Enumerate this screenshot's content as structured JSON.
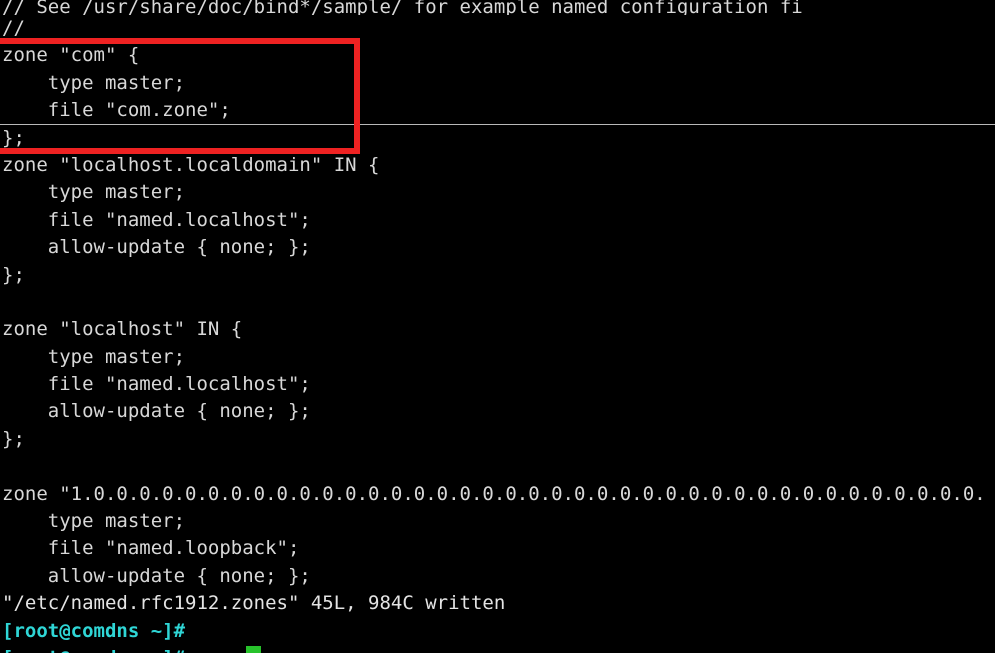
{
  "terminal": {
    "background_color": "#000000",
    "foreground_color": "#d8d8d8",
    "prompt_color": "#2fd6d6",
    "cursor_color": "#27c22b",
    "separator_color": "#b9b9b9",
    "font_size_px": 19,
    "line_height_px": 27.4
  },
  "annotation": {
    "highlight_color": "#ee2222",
    "shape": "rectangle",
    "target_label": "com-zone-block"
  },
  "lines": [
    {
      "id": "l0",
      "text": "// See /usr/share/doc/bind*/sample/ for example named configuration fi",
      "kind": "comment"
    },
    {
      "id": "l1",
      "text": "//",
      "kind": "comment"
    },
    {
      "id": "l2",
      "text": "zone \"com\" {",
      "kind": "config"
    },
    {
      "id": "l3",
      "text": "    type master;",
      "kind": "config"
    },
    {
      "id": "l4",
      "text": "    file \"com.zone\";",
      "kind": "config"
    },
    {
      "id": "l5",
      "text": "};",
      "kind": "config"
    },
    {
      "id": "l6",
      "text": "zone \"localhost.localdomain\" IN {",
      "kind": "config"
    },
    {
      "id": "l7",
      "text": "    type master;",
      "kind": "config"
    },
    {
      "id": "l8",
      "text": "    file \"named.localhost\";",
      "kind": "config"
    },
    {
      "id": "l9",
      "text": "    allow-update { none; };",
      "kind": "config"
    },
    {
      "id": "l10",
      "text": "};",
      "kind": "config"
    },
    {
      "id": "l11",
      "text": "",
      "kind": "blank"
    },
    {
      "id": "l12",
      "text": "zone \"localhost\" IN {",
      "kind": "config"
    },
    {
      "id": "l13",
      "text": "    type master;",
      "kind": "config"
    },
    {
      "id": "l14",
      "text": "    file \"named.localhost\";",
      "kind": "config"
    },
    {
      "id": "l15",
      "text": "    allow-update { none; };",
      "kind": "config"
    },
    {
      "id": "l16",
      "text": "};",
      "kind": "config"
    },
    {
      "id": "l17",
      "text": "",
      "kind": "blank"
    },
    {
      "id": "l18",
      "text": "zone \"1.0.0.0.0.0.0.0.0.0.0.0.0.0.0.0.0.0.0.0.0.0.0.0.0.0.0.0.0.0.0.0.0.0.0.0.0.0.0.0.",
      "kind": "config"
    },
    {
      "id": "l19",
      "text": "    type master;",
      "kind": "config"
    },
    {
      "id": "l20",
      "text": "    file \"named.loopback\";",
      "kind": "config"
    },
    {
      "id": "l21",
      "text": "    allow-update { none; };",
      "kind": "config"
    },
    {
      "id": "l22",
      "text": "\"/etc/named.rfc1912.zones\" 45L, 984C written",
      "kind": "status"
    },
    {
      "id": "l23",
      "text": "[root@comdns ~]#",
      "kind": "prompt"
    },
    {
      "id": "l24",
      "text": "[root@comdns ~]#",
      "kind": "prompt-partial"
    }
  ],
  "status_line": {
    "file": "/etc/named.rfc1912.zones",
    "lines": "45L",
    "bytes": "984C",
    "action": "written",
    "full_text": "\"/etc/named.rfc1912.zones\" 45L, 984C written"
  },
  "shell_prompt": {
    "user": "root",
    "host": "comdns",
    "cwd": "~",
    "symbol": "#",
    "full_text": "[root@comdns ~]#"
  }
}
